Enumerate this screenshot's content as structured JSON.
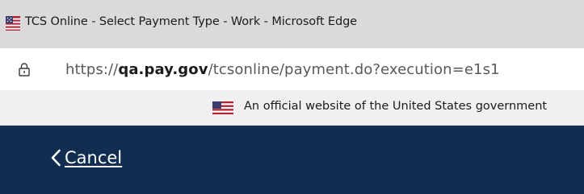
{
  "window": {
    "title": "TCS Online - Select Payment Type - Work - Microsoft Edge",
    "app_icon": "us-flag-icon"
  },
  "address_bar": {
    "scheme": "https://",
    "host": "qa.pay.gov",
    "path": "/tcsonline/payment.do?execution=e1s1",
    "lock_icon": "lock-icon"
  },
  "gov_banner": {
    "flag_icon": "us-flag-icon",
    "text": "An official website of the United States government"
  },
  "header_nav": {
    "cancel_label": "Cancel",
    "cancel_icon": "chevron-left-icon",
    "background_color": "#112e51"
  }
}
